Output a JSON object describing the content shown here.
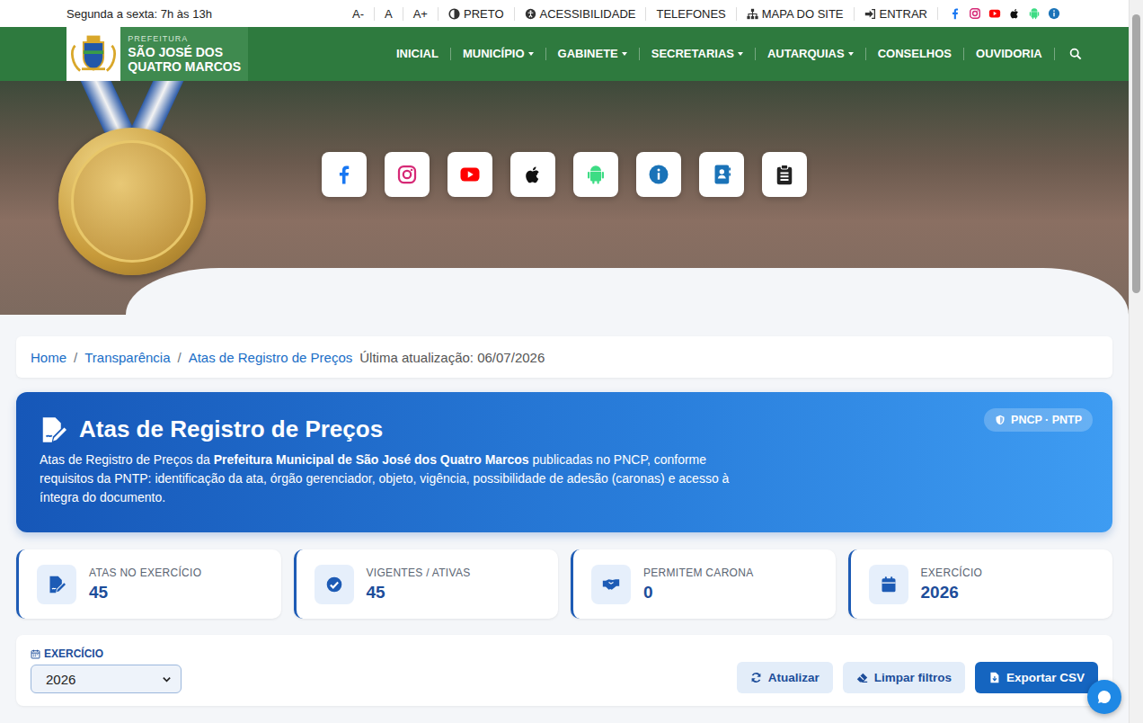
{
  "topbar": {
    "hours": "Segunda a sexta: 7h às 13h",
    "font_sizes": [
      "A-",
      "A",
      "A+"
    ],
    "links": [
      {
        "label": "PRETO"
      },
      {
        "label": "ACESSIBILIDADE"
      },
      {
        "label": "TELEFONES"
      },
      {
        "label": "MAPA DO SITE"
      },
      {
        "label": "ENTRAR"
      }
    ]
  },
  "nav": {
    "logo": {
      "kicker": "PREFEITURA",
      "name_lines": [
        "SÃO JOSÉ DOS",
        "QUATRO MARCOS"
      ]
    },
    "items": [
      {
        "label": "INICIAL",
        "dropdown": false
      },
      {
        "label": "MUNICÍPIO",
        "dropdown": true
      },
      {
        "label": "GABINETE",
        "dropdown": true
      },
      {
        "label": "SECRETARIAS",
        "dropdown": true
      },
      {
        "label": "AUTARQUIAS",
        "dropdown": true
      },
      {
        "label": "CONSELHOS",
        "dropdown": false
      },
      {
        "label": "OUVIDORIA",
        "dropdown": false
      }
    ]
  },
  "breadcrumb": {
    "items": [
      "Home",
      "Transparência",
      "Atas de Registro de Preços"
    ],
    "updated": "Última atualização: 06/07/2026"
  },
  "header": {
    "title": "Atas de Registro de Preços",
    "description": [
      {
        "text": "Atas de Registro de Preços da ",
        "bold": false
      },
      {
        "text": "Prefeitura Municipal de São José dos Quatro Marcos",
        "bold": true
      },
      {
        "text": " publicadas no PNCP, conforme requisitos da PNTP: identificação da ata, órgão gerenciador, objeto, vigência, possibilidade de adesão (caronas) e acesso à íntegra do documento.",
        "bold": false
      }
    ],
    "badge": "PNCP · PNTP"
  },
  "stats": [
    {
      "label": "ATAS NO EXERCÍCIO",
      "value": "45"
    },
    {
      "label": "VIGENTES / ATIVAS",
      "value": "45"
    },
    {
      "label": "PERMITEM CARONA",
      "value": "0"
    },
    {
      "label": "EXERCÍCIO",
      "value": "2026"
    }
  ],
  "filter": {
    "label": "EXERCÍCIO",
    "value": "2026"
  },
  "buttons": [
    {
      "label": "Atualizar",
      "kind": "secondary"
    },
    {
      "label": "Limpar filtros",
      "kind": "secondary"
    },
    {
      "label": "Exportar CSV",
      "kind": "primary"
    }
  ]
}
